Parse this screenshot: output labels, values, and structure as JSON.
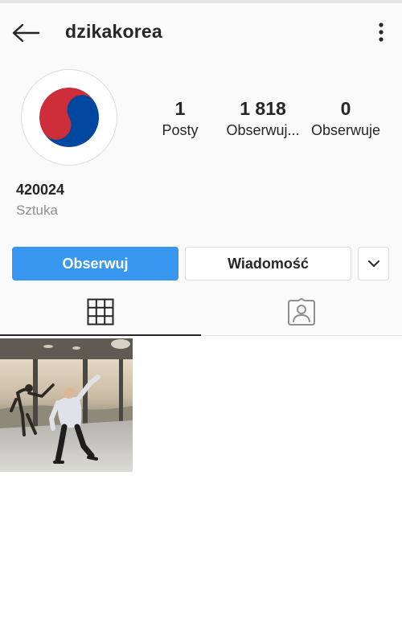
{
  "header": {
    "username": "dzikakorea",
    "back_icon": "arrow-left-icon",
    "more_icon": "more-vertical-icon"
  },
  "profile": {
    "avatar_icon": "korea-taegeuk-avatar",
    "stats": {
      "posts": {
        "count": "1",
        "label": "Posty"
      },
      "followers": {
        "count": "1 818",
        "label": "Obserwuj..."
      },
      "following": {
        "count": "0",
        "label": "Obserwuje"
      }
    },
    "bio": {
      "name": "420024",
      "category": "Sztuka"
    }
  },
  "actions": {
    "follow_label": "Obserwuj",
    "message_label": "Wiadomość",
    "dropdown_icon": "chevron-down-icon"
  },
  "tabs": [
    {
      "icon": "grid-icon",
      "active": true
    },
    {
      "icon": "tagged-person-icon",
      "active": false
    }
  ],
  "posts": [
    {
      "icon": "post-photo-two-people-dancing"
    }
  ],
  "colors": {
    "accent": "#3897f0",
    "text": "#262626",
    "muted": "#8e8e8e",
    "border": "#dbdbdb",
    "background": "#fafafa",
    "flag_red": "#cd2e3a",
    "flag_blue": "#0047a0"
  }
}
